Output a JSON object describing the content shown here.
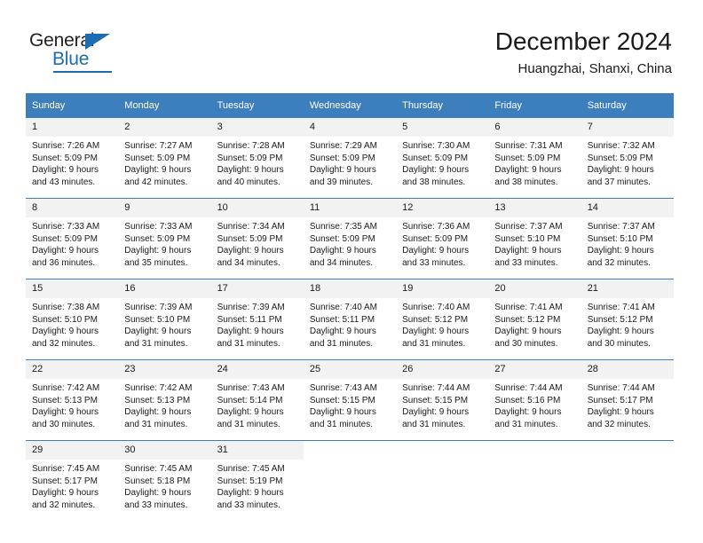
{
  "brand": {
    "name_top": "General",
    "name_bottom": "Blue",
    "accent_color": "#1b6cb0"
  },
  "header": {
    "title": "December 2024",
    "location": "Huangzhai, Shanxi, China"
  },
  "theme": {
    "header_row_bg": "#3d7ebd",
    "daynum_bg": "#f2f2f2",
    "row_border": "#3d7ebd",
    "text": "#1a1a1a"
  },
  "weekday_headers": [
    "Sunday",
    "Monday",
    "Tuesday",
    "Wednesday",
    "Thursday",
    "Friday",
    "Saturday"
  ],
  "weeks": [
    [
      {
        "day": "1",
        "sunrise": "Sunrise: 7:26 AM",
        "sunset": "Sunset: 5:09 PM",
        "daylight": "Daylight: 9 hours and 43 minutes."
      },
      {
        "day": "2",
        "sunrise": "Sunrise: 7:27 AM",
        "sunset": "Sunset: 5:09 PM",
        "daylight": "Daylight: 9 hours and 42 minutes."
      },
      {
        "day": "3",
        "sunrise": "Sunrise: 7:28 AM",
        "sunset": "Sunset: 5:09 PM",
        "daylight": "Daylight: 9 hours and 40 minutes."
      },
      {
        "day": "4",
        "sunrise": "Sunrise: 7:29 AM",
        "sunset": "Sunset: 5:09 PM",
        "daylight": "Daylight: 9 hours and 39 minutes."
      },
      {
        "day": "5",
        "sunrise": "Sunrise: 7:30 AM",
        "sunset": "Sunset: 5:09 PM",
        "daylight": "Daylight: 9 hours and 38 minutes."
      },
      {
        "day": "6",
        "sunrise": "Sunrise: 7:31 AM",
        "sunset": "Sunset: 5:09 PM",
        "daylight": "Daylight: 9 hours and 38 minutes."
      },
      {
        "day": "7",
        "sunrise": "Sunrise: 7:32 AM",
        "sunset": "Sunset: 5:09 PM",
        "daylight": "Daylight: 9 hours and 37 minutes."
      }
    ],
    [
      {
        "day": "8",
        "sunrise": "Sunrise: 7:33 AM",
        "sunset": "Sunset: 5:09 PM",
        "daylight": "Daylight: 9 hours and 36 minutes."
      },
      {
        "day": "9",
        "sunrise": "Sunrise: 7:33 AM",
        "sunset": "Sunset: 5:09 PM",
        "daylight": "Daylight: 9 hours and 35 minutes."
      },
      {
        "day": "10",
        "sunrise": "Sunrise: 7:34 AM",
        "sunset": "Sunset: 5:09 PM",
        "daylight": "Daylight: 9 hours and 34 minutes."
      },
      {
        "day": "11",
        "sunrise": "Sunrise: 7:35 AM",
        "sunset": "Sunset: 5:09 PM",
        "daylight": "Daylight: 9 hours and 34 minutes."
      },
      {
        "day": "12",
        "sunrise": "Sunrise: 7:36 AM",
        "sunset": "Sunset: 5:09 PM",
        "daylight": "Daylight: 9 hours and 33 minutes."
      },
      {
        "day": "13",
        "sunrise": "Sunrise: 7:37 AM",
        "sunset": "Sunset: 5:10 PM",
        "daylight": "Daylight: 9 hours and 33 minutes."
      },
      {
        "day": "14",
        "sunrise": "Sunrise: 7:37 AM",
        "sunset": "Sunset: 5:10 PM",
        "daylight": "Daylight: 9 hours and 32 minutes."
      }
    ],
    [
      {
        "day": "15",
        "sunrise": "Sunrise: 7:38 AM",
        "sunset": "Sunset: 5:10 PM",
        "daylight": "Daylight: 9 hours and 32 minutes."
      },
      {
        "day": "16",
        "sunrise": "Sunrise: 7:39 AM",
        "sunset": "Sunset: 5:10 PM",
        "daylight": "Daylight: 9 hours and 31 minutes."
      },
      {
        "day": "17",
        "sunrise": "Sunrise: 7:39 AM",
        "sunset": "Sunset: 5:11 PM",
        "daylight": "Daylight: 9 hours and 31 minutes."
      },
      {
        "day": "18",
        "sunrise": "Sunrise: 7:40 AM",
        "sunset": "Sunset: 5:11 PM",
        "daylight": "Daylight: 9 hours and 31 minutes."
      },
      {
        "day": "19",
        "sunrise": "Sunrise: 7:40 AM",
        "sunset": "Sunset: 5:12 PM",
        "daylight": "Daylight: 9 hours and 31 minutes."
      },
      {
        "day": "20",
        "sunrise": "Sunrise: 7:41 AM",
        "sunset": "Sunset: 5:12 PM",
        "daylight": "Daylight: 9 hours and 30 minutes."
      },
      {
        "day": "21",
        "sunrise": "Sunrise: 7:41 AM",
        "sunset": "Sunset: 5:12 PM",
        "daylight": "Daylight: 9 hours and 30 minutes."
      }
    ],
    [
      {
        "day": "22",
        "sunrise": "Sunrise: 7:42 AM",
        "sunset": "Sunset: 5:13 PM",
        "daylight": "Daylight: 9 hours and 30 minutes."
      },
      {
        "day": "23",
        "sunrise": "Sunrise: 7:42 AM",
        "sunset": "Sunset: 5:13 PM",
        "daylight": "Daylight: 9 hours and 31 minutes."
      },
      {
        "day": "24",
        "sunrise": "Sunrise: 7:43 AM",
        "sunset": "Sunset: 5:14 PM",
        "daylight": "Daylight: 9 hours and 31 minutes."
      },
      {
        "day": "25",
        "sunrise": "Sunrise: 7:43 AM",
        "sunset": "Sunset: 5:15 PM",
        "daylight": "Daylight: 9 hours and 31 minutes."
      },
      {
        "day": "26",
        "sunrise": "Sunrise: 7:44 AM",
        "sunset": "Sunset: 5:15 PM",
        "daylight": "Daylight: 9 hours and 31 minutes."
      },
      {
        "day": "27",
        "sunrise": "Sunrise: 7:44 AM",
        "sunset": "Sunset: 5:16 PM",
        "daylight": "Daylight: 9 hours and 31 minutes."
      },
      {
        "day": "28",
        "sunrise": "Sunrise: 7:44 AM",
        "sunset": "Sunset: 5:17 PM",
        "daylight": "Daylight: 9 hours and 32 minutes."
      }
    ],
    [
      {
        "day": "29",
        "sunrise": "Sunrise: 7:45 AM",
        "sunset": "Sunset: 5:17 PM",
        "daylight": "Daylight: 9 hours and 32 minutes."
      },
      {
        "day": "30",
        "sunrise": "Sunrise: 7:45 AM",
        "sunset": "Sunset: 5:18 PM",
        "daylight": "Daylight: 9 hours and 33 minutes."
      },
      {
        "day": "31",
        "sunrise": "Sunrise: 7:45 AM",
        "sunset": "Sunset: 5:19 PM",
        "daylight": "Daylight: 9 hours and 33 minutes."
      },
      {
        "day": "",
        "sunrise": "",
        "sunset": "",
        "daylight": ""
      },
      {
        "day": "",
        "sunrise": "",
        "sunset": "",
        "daylight": ""
      },
      {
        "day": "",
        "sunrise": "",
        "sunset": "",
        "daylight": ""
      },
      {
        "day": "",
        "sunrise": "",
        "sunset": "",
        "daylight": ""
      }
    ]
  ]
}
